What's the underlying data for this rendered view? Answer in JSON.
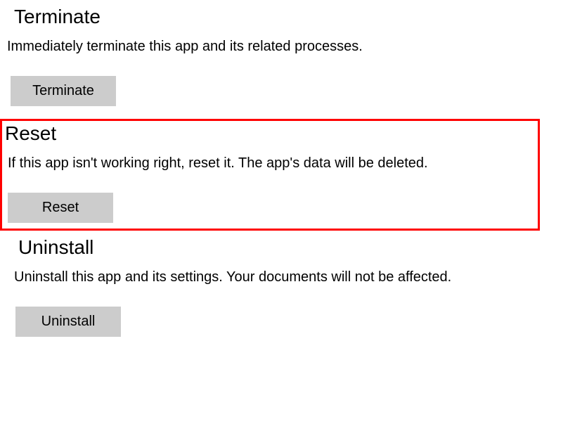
{
  "terminate": {
    "heading": "Terminate",
    "description": "Immediately terminate this app and its related processes.",
    "button_label": "Terminate"
  },
  "reset": {
    "heading": "Reset",
    "description": "If this app isn't working right, reset it. The app's data will be deleted.",
    "button_label": "Reset"
  },
  "uninstall": {
    "heading": "Uninstall",
    "description": "Uninstall this app and its settings. Your documents will not be affected.",
    "button_label": "Uninstall"
  }
}
